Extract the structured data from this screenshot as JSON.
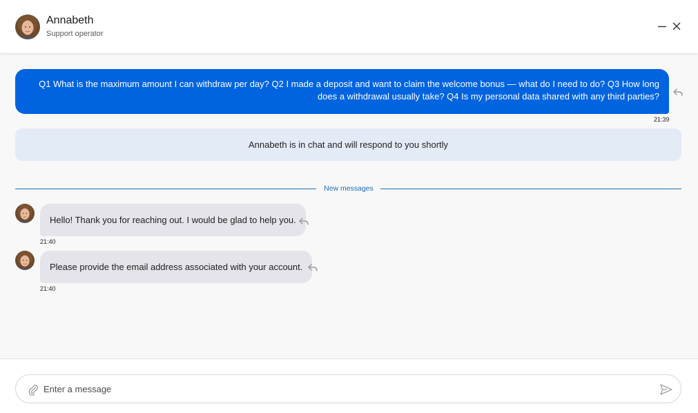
{
  "header": {
    "name": "Annabeth",
    "role": "Support operator"
  },
  "messages": {
    "outgoing": {
      "text": "Q1 What is the maximum amount I can withdraw per day? Q2 I made a deposit and want to claim the welcome bonus — what do I need to do? Q3 How long does a withdrawal usually take? Q4 Is my personal data shared with any third parties?",
      "time": "21:39"
    },
    "system_note": "Annabeth is in chat and will respond to you shortly",
    "divider_label": "New messages",
    "incoming": [
      {
        "text": "Hello! Thank you for reaching out. I would be glad to help you.",
        "time": "21:40"
      },
      {
        "text": "Please provide the email address associated with your account.",
        "time": "21:40"
      }
    ]
  },
  "composer": {
    "placeholder": "Enter a message"
  },
  "icons": {
    "minimize": "minimize-icon",
    "close": "close-icon",
    "reply": "reply-icon",
    "attach": "paperclip-icon",
    "send": "send-icon"
  },
  "colors": {
    "outgoing_bubble": "#0064e0",
    "incoming_bubble": "#e4e4ea",
    "system_note": "#e3ebf7",
    "accent": "#1a6fb5"
  }
}
